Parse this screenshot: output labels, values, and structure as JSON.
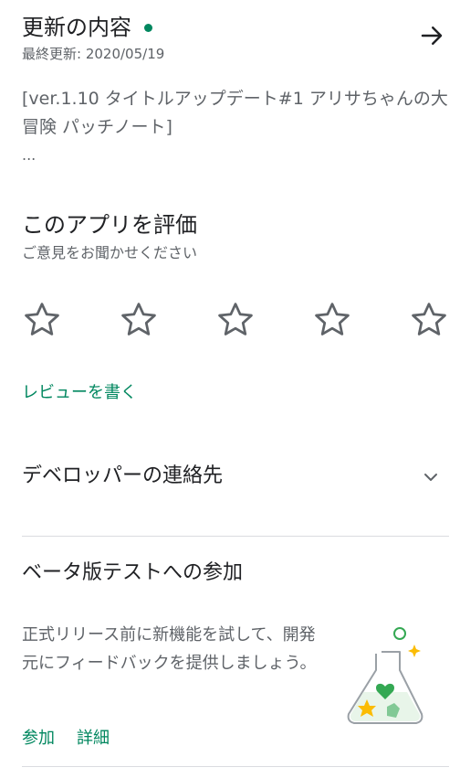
{
  "whats_new": {
    "title": "更新の内容",
    "last_updated": "最終更新: 2020/05/19",
    "body": "[ver.1.10 タイトルアップデート#1 アリサちゃんの大冒険 パッチノート]",
    "ellipsis": "...",
    "arrow_icon": "arrow-right-icon",
    "dot_color": "#01875f"
  },
  "rate": {
    "title": "このアプリを評価",
    "subtitle": "ご意見をお聞かせください",
    "stars_total": 5,
    "stars_filled": 0,
    "write_review": "レビューを書く"
  },
  "developer": {
    "title": "デベロッパーの連絡先",
    "chevron_icon": "chevron-down-icon"
  },
  "beta": {
    "title": "ベータ版テストへの参加",
    "body": "正式リリース前に新機能を試して、開発元にフィードバックを提供しましょう。",
    "join": "参加",
    "details": "詳細",
    "illustration": "flask-icon"
  },
  "colors": {
    "accent": "#01875f",
    "text_primary": "#202124",
    "text_secondary": "#5f6368",
    "divider": "#dadce0"
  }
}
